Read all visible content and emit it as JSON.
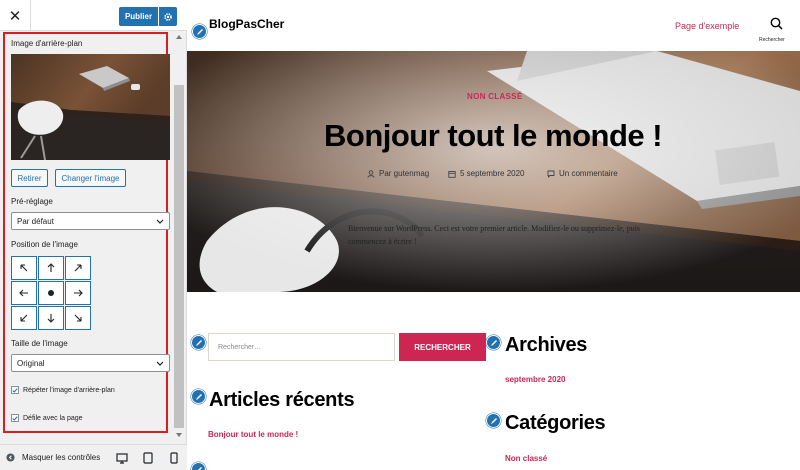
{
  "sidebar": {
    "close_label": "✕",
    "publish_label": "Publier",
    "section_label": "Image d'arrière-plan",
    "remove_label": "Retirer",
    "change_label": "Changer l'image",
    "preset_label": "Pré-réglage",
    "preset_value": "Par défaut",
    "position_label": "Position de l'image",
    "size_label": "Taille de l'image",
    "size_value": "Original",
    "repeat_label": "Répéter l'image d'arrière-plan",
    "repeat_checked": true,
    "scroll_label": "Défile avec la page",
    "scroll_checked": true,
    "hide_controls_label": "Masquer les contrôles"
  },
  "preview": {
    "site_title": "BlogPasCher",
    "nav_link": "Page d'exemple",
    "search_caption": "Rechercher",
    "hero": {
      "category": "NON CLASSÉ",
      "title": "Bonjour tout le monde !",
      "author": "Par gutenmag",
      "date": "5 septembre 2020",
      "comments": "Un commentaire",
      "excerpt": "Bienvenue sur WordPress. Ceci est votre premier article. Modifiez-le ou supprimez-le, puis commencez à écrire !"
    },
    "search_placeholder": "Rechercher…",
    "search_button": "RECHERCHER",
    "widgets": {
      "recent_title": "Articles récents",
      "recent_item": "Bonjour tout le monde !",
      "archives_title": "Archives",
      "archives_item": "septembre 2020",
      "categories_title": "Catégories",
      "categories_item": "Non classé"
    }
  },
  "colors": {
    "accent": "#cd2653",
    "wp_blue": "#2271b1",
    "highlight": "#d81e1e"
  }
}
